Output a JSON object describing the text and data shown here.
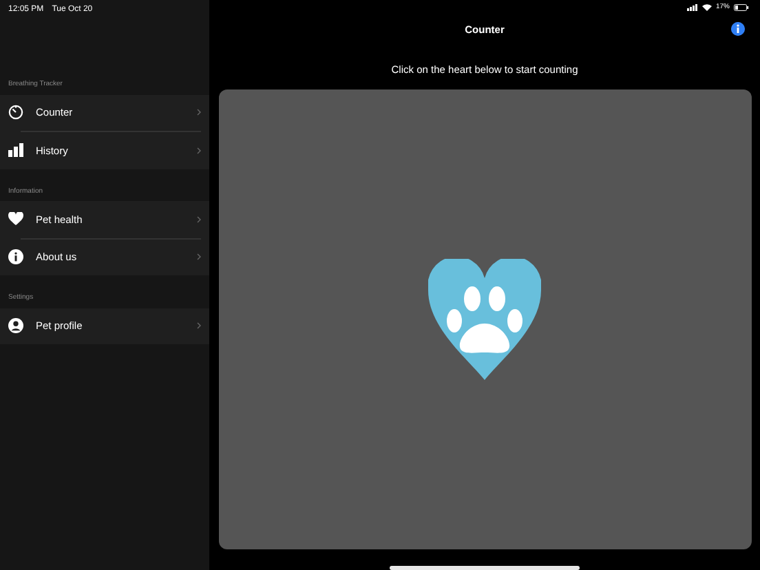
{
  "status_bar": {
    "time": "12:05 PM",
    "date": "Tue Oct 20",
    "battery": "17%"
  },
  "sidebar": {
    "sections": [
      {
        "header": "Breathing Tracker",
        "items": [
          {
            "label": "Counter",
            "kind": "timer"
          },
          {
            "label": "History",
            "kind": "chart"
          }
        ]
      },
      {
        "header": "Information",
        "items": [
          {
            "label": "Pet health",
            "kind": "heart"
          },
          {
            "label": "About us",
            "kind": "info"
          }
        ]
      },
      {
        "header": "Settings",
        "items": [
          {
            "label": "Pet profile",
            "kind": "person"
          }
        ]
      }
    ]
  },
  "main": {
    "title": "Counter",
    "instruction": "Click on the heart below to start counting"
  }
}
